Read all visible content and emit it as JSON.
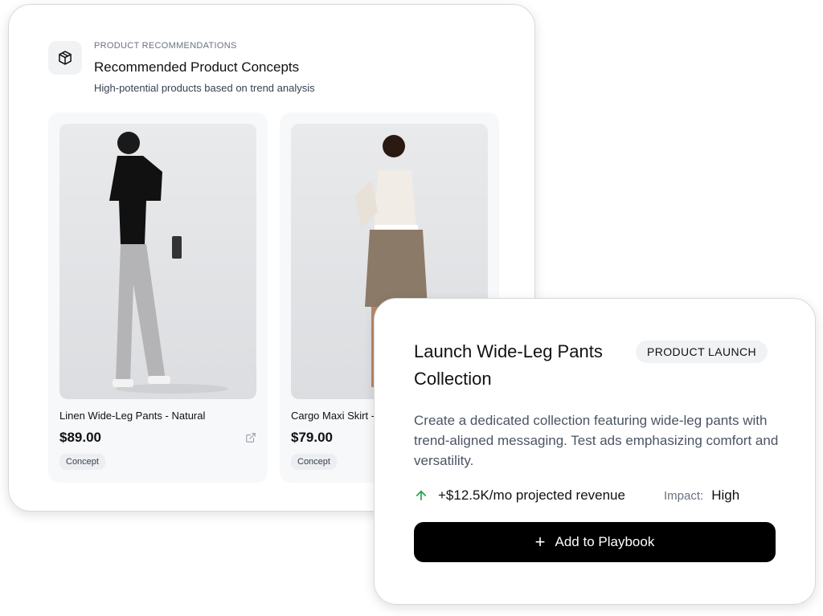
{
  "recommendations": {
    "eyebrow": "PRODUCT RECOMMENDATIONS",
    "title": "Recommended Product Concepts",
    "subtitle": "High-potential products based on trend analysis",
    "icon": "package-icon",
    "products": [
      {
        "name": "Linen Wide-Leg Pants - Natural",
        "price": "$89.00",
        "badge": "Concept",
        "image": "model-wearing-grey-wide-leg-pants"
      },
      {
        "name": "Cargo Maxi Skirt - Olive",
        "price": "$79.00",
        "badge": "Concept",
        "image": "model-wearing-khaki-skirt"
      }
    ]
  },
  "launch_card": {
    "title": "Launch Wide-Leg Pants Collection",
    "badge": "PRODUCT LAUNCH",
    "description": "Create a dedicated collection featuring wide-leg pants with trend-aligned messaging. Test ads emphasizing comfort and versatility.",
    "revenue": "+$12.5K/mo projected revenue",
    "impact_label": "Impact:",
    "impact_value": "High",
    "button_label": "Add to Playbook"
  },
  "colors": {
    "accent_green": "#22a34a",
    "button_bg": "#000000"
  }
}
